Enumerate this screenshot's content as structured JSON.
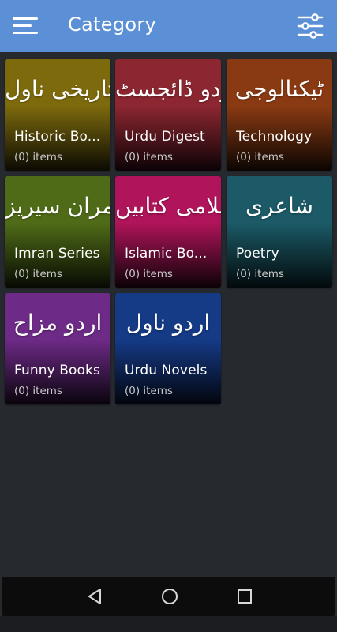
{
  "appbar": {
    "title": "Category",
    "menu_icon": "hamburger-menu-icon",
    "filter_icon": "sliders-filter-icon",
    "background": "#5b8fd6"
  },
  "categories": [
    {
      "urdu": "تاریخی ناول",
      "name": "Historic Bo...",
      "count": "(0) items",
      "color_top": "#7d6a0d",
      "color_bottom": "#0c0a03"
    },
    {
      "urdu": "اردو ڈائجسٹ",
      "name": "Urdu Digest",
      "count": "(0) items",
      "color_top": "#8c2630",
      "color_bottom": "#0c0306"
    },
    {
      "urdu": "ٹیکنالوجی",
      "name": "Technology",
      "count": "(0) items",
      "color_top": "#8a3a12",
      "color_bottom": "#0b0502"
    },
    {
      "urdu": "عمران سیریز",
      "name": "Imran Series",
      "count": "(0) items",
      "color_top": "#4f6b17",
      "color_bottom": "#070a03"
    },
    {
      "urdu": "اسلامی کتابیں",
      "name": "Islamic Bo...",
      "count": "(0) items",
      "color_top": "#b0145a",
      "color_bottom": "#0c0207"
    },
    {
      "urdu": "شاعری",
      "name": "Poetry",
      "count": "(0) items",
      "color_top": "#1b5a66",
      "color_bottom": "#030a0c"
    },
    {
      "urdu": "اردو مزاح",
      "name": "Funny Books",
      "count": "(0) items",
      "color_top": "#6d2a86",
      "color_bottom": "#09040c"
    },
    {
      "urdu": "اردو ناول",
      "name": "Urdu Novels",
      "count": "(0) items",
      "color_top": "#153a86",
      "color_bottom": "#02050c"
    }
  ],
  "navbar": {
    "back_icon": "back-triangle-icon",
    "home_icon": "home-circle-icon",
    "recents_icon": "recents-square-icon"
  }
}
